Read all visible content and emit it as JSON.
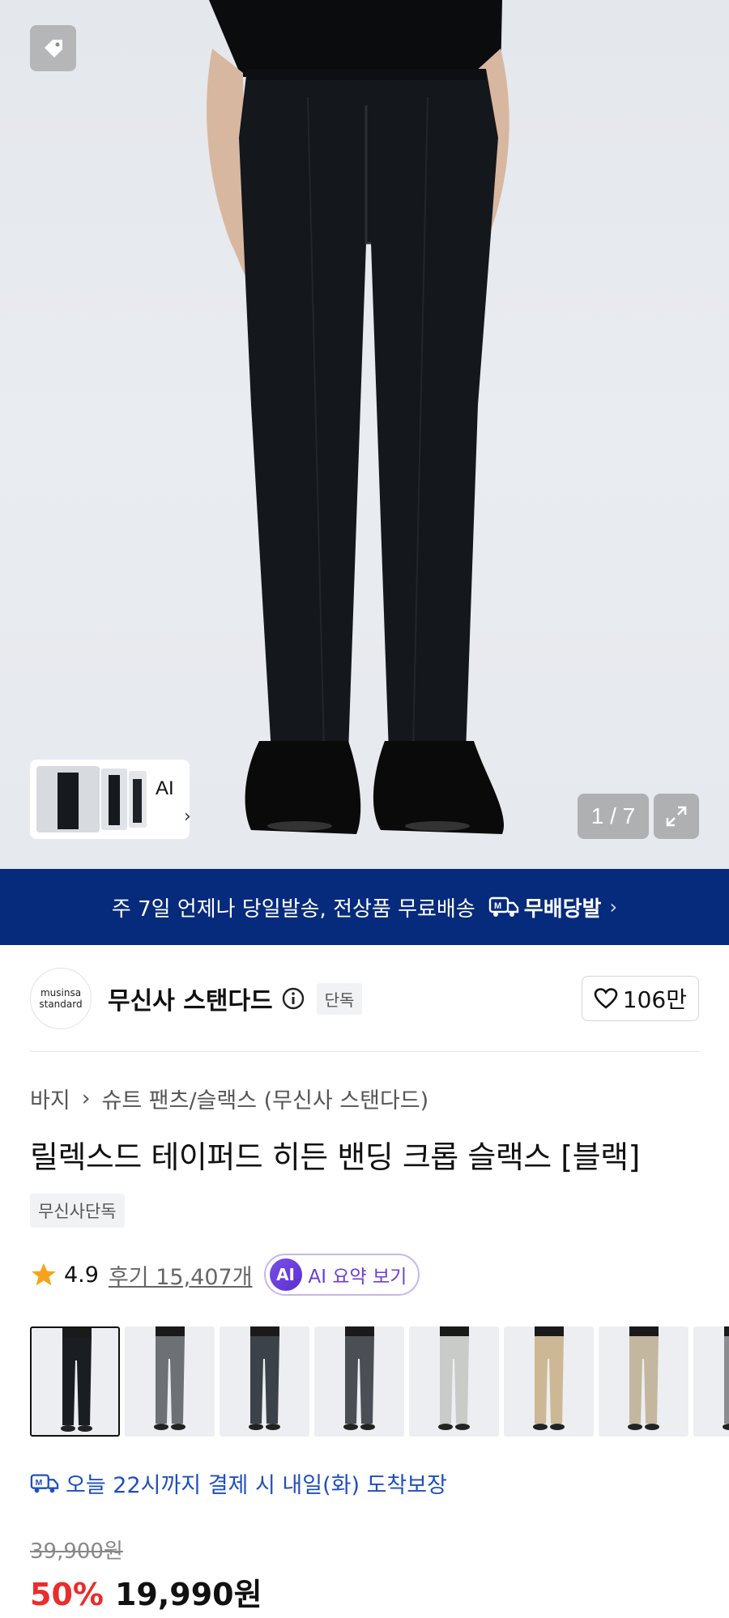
{
  "hero": {
    "counter": "1 / 7",
    "ai_label": "AI"
  },
  "banner": {
    "text": "주 7일 언제나 당일발송, 전상품 무료배송",
    "brand": "무배당발"
  },
  "brand": {
    "logo_line1": "musinsa",
    "logo_line2": "standard",
    "name": "무신사 스탠다드",
    "badge": "단독",
    "likes": "106만"
  },
  "breadcrumb": {
    "category": "바지",
    "subcategory": "슈트 팬츠/슬랙스 (무신사 스탠다드)"
  },
  "product": {
    "title": "릴렉스드 테이퍼드 히든 밴딩 크롭 슬랙스 [블랙]",
    "exclusive_tag": "무신사단독",
    "rating": "4.9",
    "reviews": "후기 15,407개",
    "ai_summary": "AI 요약 보기",
    "ai_badge": "AI"
  },
  "swatches": [
    {
      "color": "#1a1d22",
      "selected": true
    },
    {
      "color": "#6d7075",
      "selected": false
    },
    {
      "color": "#3c4249",
      "selected": false
    },
    {
      "color": "#4b4e54",
      "selected": false
    },
    {
      "color": "#c9cbc9",
      "selected": false
    },
    {
      "color": "#cdb896",
      "selected": false
    },
    {
      "color": "#c4b7a0",
      "selected": false
    },
    {
      "color": "#8a8c90",
      "selected": false
    }
  ],
  "delivery": {
    "text": "오늘 22시까지 결제 시 내일(화) 도착보장"
  },
  "price": {
    "original": "39,900원",
    "discount": "50%",
    "final": "19,990원"
  },
  "colors": {
    "banner_bg": "#062a7c",
    "discount": "#ea2c2c",
    "delivery": "#1f4fbf",
    "ai_purple": "#6b3fd6"
  }
}
